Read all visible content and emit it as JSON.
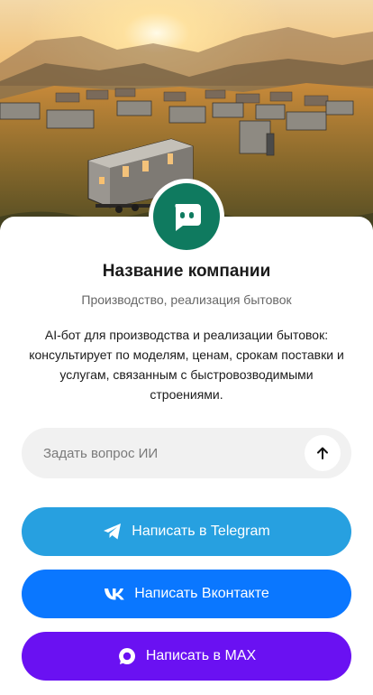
{
  "company": {
    "name": "Название компании",
    "category": "Производство, реализация бытовок",
    "description": "AI-бот для производства и реализации бытовок: консультирует по моделям, ценам, срокам поставки и услугам, связанным с быстровозводимыми строениями."
  },
  "ask": {
    "placeholder": "Задать вопрос ИИ"
  },
  "buttons": {
    "telegram": {
      "label": "Написать в Telegram",
      "color": "#27a0e0"
    },
    "vk": {
      "label": "Написать Вконтакте",
      "color": "#0a77ff"
    },
    "max": {
      "label": "Написать в MAX",
      "color": "#6a11f2"
    }
  },
  "colors": {
    "avatar": "#0f7a5f"
  }
}
